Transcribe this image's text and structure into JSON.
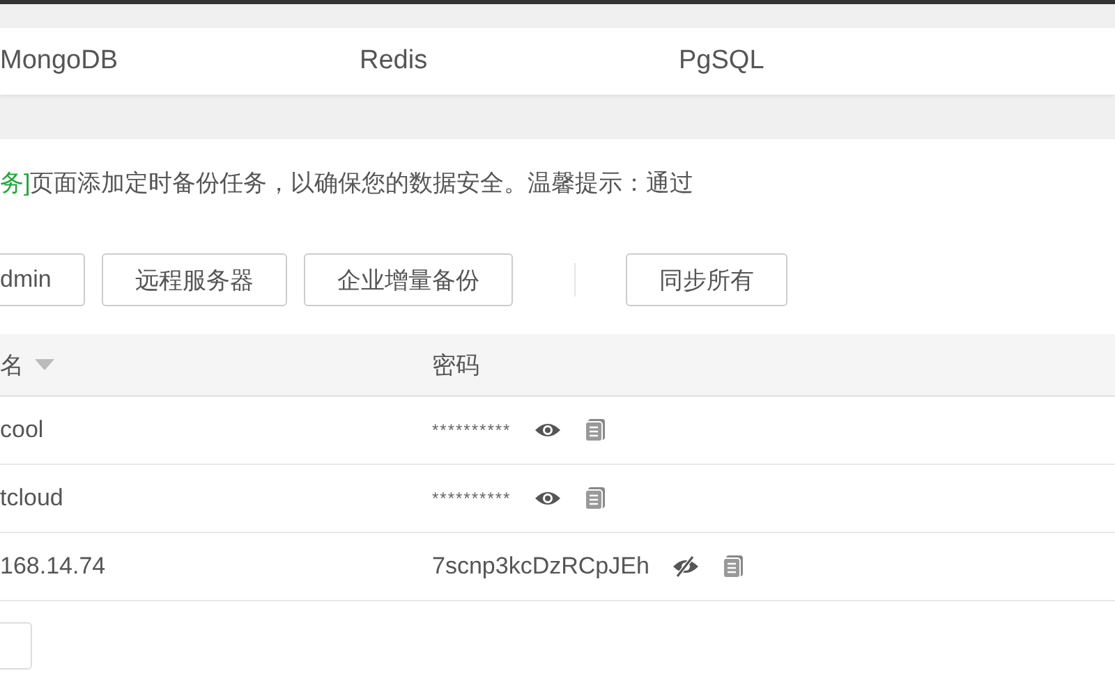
{
  "tabs": [
    {
      "label": "MongoDB",
      "selected": false
    },
    {
      "label": "Redis",
      "selected": false
    },
    {
      "label": "PgSQL",
      "selected": false
    }
  ],
  "notice": {
    "link": "务]",
    "text": "页面添加定时备份任务，以确保您的数据安全。温馨提示：通过"
  },
  "toolbar": {
    "left": [
      "dmin",
      "远程服务器",
      "企业增量备份"
    ],
    "right": [
      "同步所有"
    ]
  },
  "table": {
    "columns": [
      "名",
      "密码"
    ],
    "rows": [
      {
        "name": "cool",
        "password": "**********",
        "visible": false
      },
      {
        "name": "tcloud",
        "password": "**********",
        "visible": false
      },
      {
        "name": "168.14.74",
        "password": "7scnp3kcDzRCpJEh",
        "visible": true
      }
    ]
  }
}
